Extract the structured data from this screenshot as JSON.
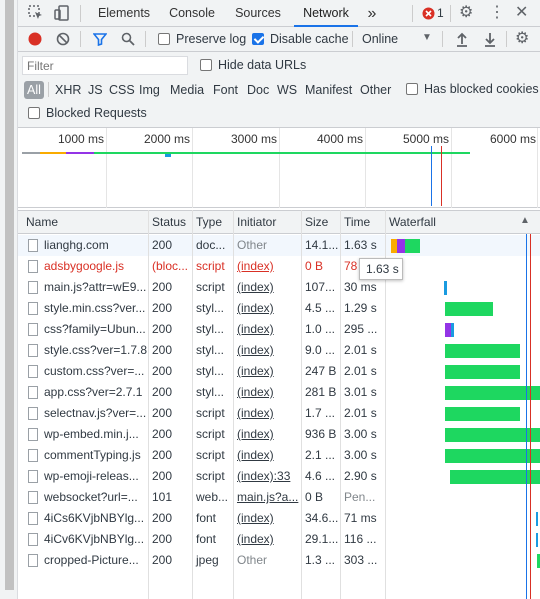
{
  "tabs": {
    "elements": "Elements",
    "console": "Console",
    "sources": "Sources",
    "network": "Network",
    "more": "»",
    "error_count": "1"
  },
  "toolbar": {
    "preserve_log": "Preserve log",
    "disable_cache": "Disable cache",
    "throttle": "Online"
  },
  "filter": {
    "placeholder": "Filter",
    "hide_data_urls": "Hide data URLs",
    "types": [
      "All",
      "XHR",
      "JS",
      "CSS",
      "Img",
      "Media",
      "Font",
      "Doc",
      "WS",
      "Manifest",
      "Other"
    ],
    "has_blocked_cookies": "Has blocked cookies",
    "blocked_requests": "Blocked Requests"
  },
  "overview": {
    "ticks": [
      "1000 ms",
      "2000 ms",
      "3000 ms",
      "4000 ms",
      "5000 ms",
      "6000 ms"
    ]
  },
  "columns": {
    "name": "Name",
    "status": "Status",
    "type": "Type",
    "initiator": "Initiator",
    "size": "Size",
    "time": "Time",
    "waterfall": "Waterfall"
  },
  "rows": [
    {
      "name": "lianghg.com",
      "status": "200",
      "type": "doc...",
      "initiator": "Other",
      "size": "14.1...",
      "time": "1.63 s",
      "wf_start": 0.02,
      "wf_parts": [
        {
          "w": 0.04,
          "c": "#f9ab00"
        },
        {
          "w": 0.05,
          "c": "#9334e6"
        },
        {
          "w": 0.1,
          "c": "#1ed760"
        }
      ],
      "err": false
    },
    {
      "name": "adsbygoogle.js",
      "status": "(bloc...",
      "type": "script",
      "initiator": "(index)",
      "size": "0 B",
      "time": "78",
      "wf_start": 0,
      "wf_parts": [],
      "err": true
    },
    {
      "name": "main.js?attr=wE9...",
      "status": "200",
      "type": "script",
      "initiator": "(index)",
      "size": "107...",
      "time": "30 ms",
      "wf_start": 0.37,
      "wf_parts": [
        {
          "w": 0.02,
          "c": "#1a9be0"
        }
      ],
      "err": false
    },
    {
      "name": "style.min.css?ver...",
      "status": "200",
      "type": "styl...",
      "initiator": "(index)",
      "size": "4.5 ...",
      "time": "1.29 s",
      "wf_start": 0.38,
      "wf_parts": [
        {
          "w": 0.32,
          "c": "#1ed760"
        }
      ],
      "err": false
    },
    {
      "name": "css?family=Ubun...",
      "status": "200",
      "type": "styl...",
      "initiator": "(index)",
      "size": "1.0 ...",
      "time": "295 ...",
      "wf_start": 0.38,
      "wf_parts": [
        {
          "w": 0.04,
          "c": "#9334e6"
        },
        {
          "w": 0.02,
          "c": "#1a9be0"
        }
      ],
      "err": false
    },
    {
      "name": "style.css?ver=1.7.8",
      "status": "200",
      "type": "styl...",
      "initiator": "(index)",
      "size": "9.0 ...",
      "time": "2.01 s",
      "wf_start": 0.38,
      "wf_parts": [
        {
          "w": 0.5,
          "c": "#1ed760"
        }
      ],
      "err": false
    },
    {
      "name": "custom.css?ver=...",
      "status": "200",
      "type": "styl...",
      "initiator": "(index)",
      "size": "247 B",
      "time": "2.01 s",
      "wf_start": 0.38,
      "wf_parts": [
        {
          "w": 0.5,
          "c": "#1ed760"
        }
      ],
      "err": false
    },
    {
      "name": "app.css?ver=2.7.1",
      "status": "200",
      "type": "styl...",
      "initiator": "(index)",
      "size": "281 B",
      "time": "3.01 s",
      "wf_start": 0.38,
      "wf_parts": [
        {
          "w": 0.74,
          "c": "#1ed760"
        }
      ],
      "err": false
    },
    {
      "name": "selectnav.js?ver=...",
      "status": "200",
      "type": "script",
      "initiator": "(index)",
      "size": "1.7 ...",
      "time": "2.01 s",
      "wf_start": 0.38,
      "wf_parts": [
        {
          "w": 0.5,
          "c": "#1ed760"
        }
      ],
      "err": false
    },
    {
      "name": "wp-embed.min.j...",
      "status": "200",
      "type": "script",
      "initiator": "(index)",
      "size": "936 B",
      "time": "3.00 s",
      "wf_start": 0.38,
      "wf_parts": [
        {
          "w": 0.74,
          "c": "#1ed760"
        }
      ],
      "err": false
    },
    {
      "name": "commentTyping.js",
      "status": "200",
      "type": "script",
      "initiator": "(index)",
      "size": "2.1 ...",
      "time": "3.00 s",
      "wf_start": 0.38,
      "wf_parts": [
        {
          "w": 0.74,
          "c": "#1ed760"
        }
      ],
      "err": false
    },
    {
      "name": "wp-emoji-releas...",
      "status": "200",
      "type": "script",
      "initiator": "(index):33",
      "size": "4.6 ...",
      "time": "2.90 s",
      "wf_start": 0.41,
      "wf_parts": [
        {
          "w": 0.71,
          "c": "#1ed760"
        }
      ],
      "err": false
    },
    {
      "name": "websocket?url=...",
      "status": "101",
      "type": "web...",
      "initiator": "main.js?a...",
      "size": "0 B",
      "time": "Pen...",
      "wf_start": 0,
      "wf_parts": [],
      "err": false
    },
    {
      "name": "4iCs6KVjbNBYlg...",
      "status": "200",
      "type": "font",
      "initiator": "(index)",
      "size": "34.6...",
      "time": "71 ms",
      "wf_start": 0.985,
      "wf_parts": [
        {
          "w": 0.015,
          "c": "#1a9be0"
        }
      ],
      "err": false
    },
    {
      "name": "4iCv6KVjbNBYlg...",
      "status": "200",
      "type": "font",
      "initiator": "(index)",
      "size": "29.1...",
      "time": "116 ...",
      "wf_start": 0.985,
      "wf_parts": [
        {
          "w": 0.015,
          "c": "#1a9be0"
        }
      ],
      "err": false
    },
    {
      "name": "cropped-Picture...",
      "status": "200",
      "type": "jpeg",
      "initiator": "Other",
      "size": "1.3 ...",
      "time": "303 ...",
      "wf_start": 0.99,
      "wf_parts": [
        {
          "w": 0.08,
          "c": "#1ed760"
        }
      ],
      "err": false
    }
  ],
  "tooltip": "1.63 s",
  "colors": {
    "accent": "#1a73e8",
    "record": "#d93025",
    "green": "#1ed760",
    "purple": "#9334e6",
    "orange": "#f9ab00",
    "blue": "#1a9be0"
  }
}
